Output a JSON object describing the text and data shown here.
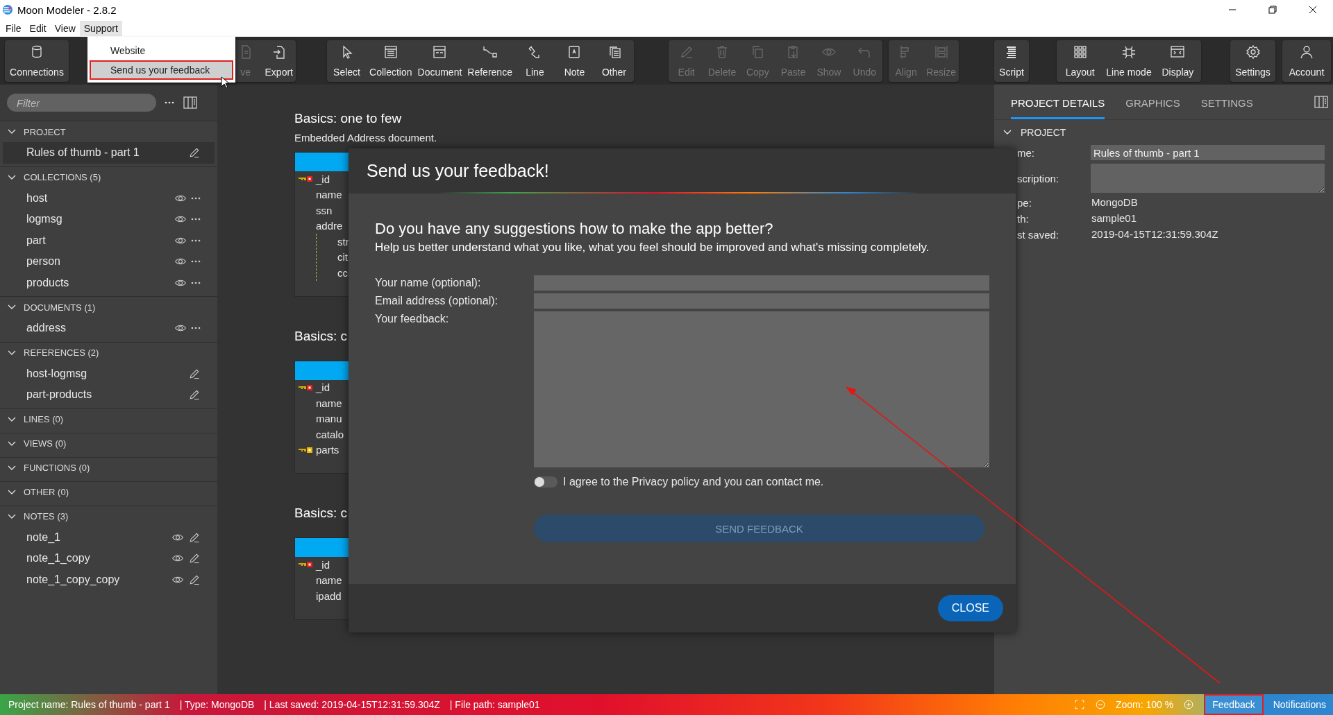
{
  "window": {
    "title": "Moon Modeler - 2.8.2"
  },
  "menu": [
    {
      "label": "File",
      "selected": false
    },
    {
      "label": "Edit",
      "selected": false
    },
    {
      "label": "View",
      "selected": false
    },
    {
      "label": "Support",
      "selected": true
    }
  ],
  "dropdown": {
    "items": [
      {
        "label": "Website",
        "selected": false,
        "annotated": false
      },
      {
        "label": "Send us your feedback",
        "selected": true,
        "annotated": true
      }
    ]
  },
  "toolbar": {
    "groups": [
      {
        "buttons": [
          {
            "label": "Connections",
            "disabled": false
          }
        ]
      },
      {
        "buttons": [
          {
            "label": "ve",
            "disabled": true
          },
          {
            "label": "Export",
            "disabled": false
          }
        ]
      },
      {
        "buttons": [
          {
            "label": "Select",
            "disabled": false
          },
          {
            "label": "Collection",
            "disabled": false
          },
          {
            "label": "Document",
            "disabled": false
          },
          {
            "label": "Reference",
            "disabled": false
          },
          {
            "label": "Line",
            "disabled": false
          },
          {
            "label": "Note",
            "disabled": false
          },
          {
            "label": "Other",
            "disabled": false
          }
        ]
      },
      {
        "buttons": [
          {
            "label": "Edit",
            "disabled": true
          },
          {
            "label": "Delete",
            "disabled": true
          },
          {
            "label": "Copy",
            "disabled": true
          },
          {
            "label": "Paste",
            "disabled": true
          },
          {
            "label": "Show",
            "disabled": true
          },
          {
            "label": "Undo",
            "disabled": true
          }
        ]
      },
      {
        "buttons": [
          {
            "label": "Align",
            "disabled": true
          },
          {
            "label": "Resize",
            "disabled": true
          }
        ]
      },
      {
        "buttons": [
          {
            "label": "Script",
            "disabled": false
          }
        ]
      },
      {
        "buttons": [
          {
            "label": "Layout",
            "disabled": false
          },
          {
            "label": "Line mode",
            "disabled": false
          },
          {
            "label": "Display",
            "disabled": false
          }
        ]
      },
      {
        "buttons": [
          {
            "label": "Settings",
            "disabled": false
          }
        ]
      },
      {
        "buttons": [
          {
            "label": "Account",
            "disabled": false
          }
        ]
      }
    ]
  },
  "sidebar": {
    "filter": {
      "placeholder": "Filter"
    },
    "sections": [
      {
        "label": "PROJECT",
        "kind": "project",
        "expanded": true,
        "items": [
          {
            "label": "Rules of thumb - part 1",
            "selected": true
          }
        ]
      },
      {
        "label": "COLLECTIONS (5)",
        "kind": "collection",
        "expanded": true,
        "items": [
          {
            "label": "host",
            "selected": false
          },
          {
            "label": "logmsg",
            "selected": false
          },
          {
            "label": "part",
            "selected": false
          },
          {
            "label": "person",
            "selected": false
          },
          {
            "label": "products",
            "selected": false
          }
        ]
      },
      {
        "label": "DOCUMENTS (1)",
        "kind": "collection",
        "expanded": true,
        "items": [
          {
            "label": "address",
            "selected": false
          }
        ]
      },
      {
        "label": "REFERENCES (2)",
        "kind": "reference",
        "expanded": true,
        "items": [
          {
            "label": "host-logmsg",
            "selected": false
          },
          {
            "label": "part-products",
            "selected": false
          }
        ]
      },
      {
        "label": "LINES (0)",
        "expanded": true
      },
      {
        "label": "VIEWS (0)",
        "expanded": true
      },
      {
        "label": "FUNCTIONS (0)",
        "expanded": true
      },
      {
        "label": "OTHER (0)",
        "expanded": true
      },
      {
        "label": "NOTES (3)",
        "kind": "note",
        "expanded": true,
        "items": [
          {
            "label": "note_1",
            "selected": false
          },
          {
            "label": "note_1_copy",
            "selected": false
          },
          {
            "label": "note_1_copy_copy",
            "selected": false
          }
        ]
      }
    ]
  },
  "canvas": {
    "diagrams": [
      {
        "title": "Basics: one to few",
        "subtitle": "Embedded Address document.",
        "fields": [
          {
            "name": "_id",
            "kind": "primary"
          },
          {
            "name": "name",
            "kind": "plain"
          },
          {
            "name": "ssn",
            "kind": "plain"
          },
          {
            "name": "addre",
            "kind": "plain",
            "children": [
              {
                "name": "str"
              },
              {
                "name": "cit"
              },
              {
                "name": "cc"
              }
            ]
          }
        ]
      },
      {
        "title": "Basics: c",
        "fields": [
          {
            "name": "_id",
            "kind": "primary"
          },
          {
            "name": "name",
            "kind": "plain"
          },
          {
            "name": "manu",
            "kind": "plain"
          },
          {
            "name": "catalo",
            "kind": "plain"
          },
          {
            "name": "parts",
            "kind": "foreign"
          }
        ]
      },
      {
        "title": "Basics: c",
        "fields": [
          {
            "name": "_id",
            "kind": "primary"
          },
          {
            "name": "name",
            "kind": "plain"
          },
          {
            "name": "ipadd",
            "kind": "plain"
          }
        ]
      }
    ]
  },
  "dialog": {
    "title": "Send us your feedback!",
    "heading": "Do you have any suggestions how to make the app better?",
    "subheading": "Help us better understand what you like, what you feel should be improved and what's missing completely.",
    "fields": [
      {
        "label": "Your name (optional):",
        "kind": "input"
      },
      {
        "label": "Email address (optional):",
        "kind": "input"
      },
      {
        "label": "Your feedback:",
        "kind": "textarea"
      }
    ],
    "consent": {
      "label": "I agree to the Privacy policy and you can contact me.",
      "on": false
    },
    "submit": {
      "label": "SEND FEEDBACK",
      "disabled": true
    },
    "close": {
      "label": "CLOSE"
    }
  },
  "details": {
    "tabs": [
      {
        "label": "PROJECT DETAILS",
        "selected": true
      },
      {
        "label": "GRAPHICS",
        "selected": false
      },
      {
        "label": "SETTINGS",
        "selected": false
      }
    ],
    "section": {
      "label": "PROJECT",
      "expanded": true
    },
    "fields": [
      {
        "label": "me:",
        "kind": "input",
        "value": "Rules of thumb - part 1"
      },
      {
        "label": "scription:",
        "kind": "textarea"
      },
      {
        "label": "pe:",
        "kind": "text",
        "value": "MongoDB"
      },
      {
        "label": "th:",
        "kind": "text",
        "value": "sample01"
      },
      {
        "label": "st saved:",
        "kind": "text",
        "value": "2019-04-15T12:31:59.304Z"
      }
    ]
  },
  "status_bar": {
    "items": [
      "Project name: Rules of thumb - part 1",
      "| Type: MongoDB",
      "| Last saved: 2019-04-15T12:31:59.304Z",
      "| File path: sample01"
    ],
    "zoom": "Zoom: 100 %",
    "buttons": [
      {
        "label": "Feedback",
        "annotated": true
      },
      {
        "label": "Notifications",
        "annotated": false
      }
    ]
  }
}
